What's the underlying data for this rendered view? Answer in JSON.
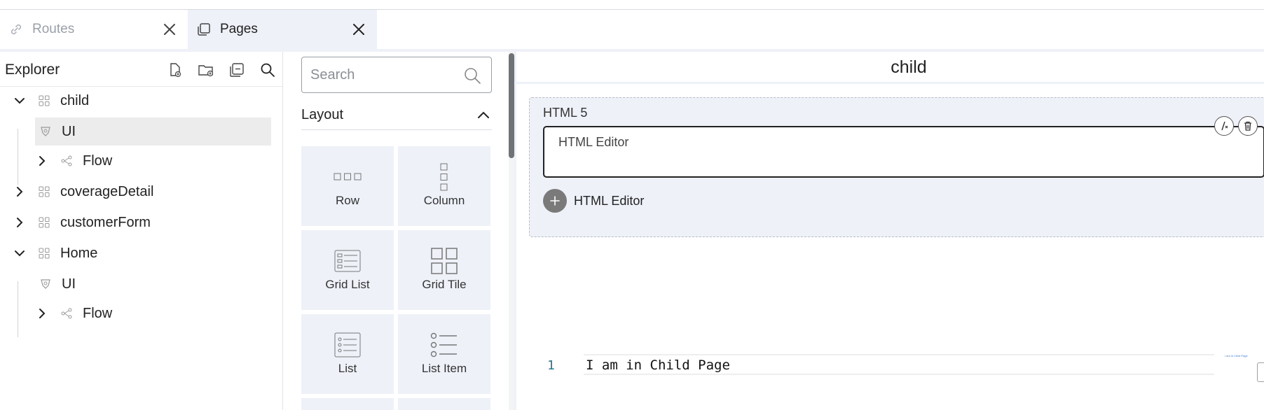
{
  "tabs": [
    {
      "label": "Routes",
      "icon": "link-icon",
      "active": false
    },
    {
      "label": "Pages",
      "icon": "pages-icon",
      "active": true
    }
  ],
  "explorer": {
    "title": "Explorer",
    "actions": [
      "new-file-icon",
      "new-folder-icon",
      "collapse-all-icon",
      "search-icon"
    ],
    "tree": [
      {
        "label": "child",
        "type": "page",
        "expanded": true
      },
      {
        "label": "UI",
        "type": "ui",
        "selected": true
      },
      {
        "label": "Flow",
        "type": "flow",
        "expanded": false
      },
      {
        "label": "coverageDetail",
        "type": "page",
        "expanded": false
      },
      {
        "label": "customerForm",
        "type": "page",
        "expanded": false
      },
      {
        "label": "Home",
        "type": "page",
        "expanded": true
      },
      {
        "label": "UI",
        "type": "ui"
      },
      {
        "label": "Flow",
        "type": "flow",
        "expanded": false
      }
    ]
  },
  "palette": {
    "search_placeholder": "Search",
    "section_title": "Layout",
    "tiles": [
      {
        "label": "Row",
        "icon": "row-icon"
      },
      {
        "label": "Column",
        "icon": "column-icon"
      },
      {
        "label": "Grid List",
        "icon": "grid-list-icon"
      },
      {
        "label": "Grid Tile",
        "icon": "grid-tile-icon"
      },
      {
        "label": "List",
        "icon": "list-icon"
      },
      {
        "label": "List Item",
        "icon": "list-item-icon"
      }
    ]
  },
  "canvas": {
    "title": "child",
    "component_label": "HTML 5",
    "editor_text": "HTML Editor",
    "add_label": "HTML Editor",
    "code": {
      "line_number": "1",
      "text": "I am in Child Page",
      "minimap": "I am in Child Page"
    }
  },
  "colors": {
    "panel_bg": "#eef1f8",
    "line_number": "#237893",
    "selected_row": "#ececec"
  }
}
